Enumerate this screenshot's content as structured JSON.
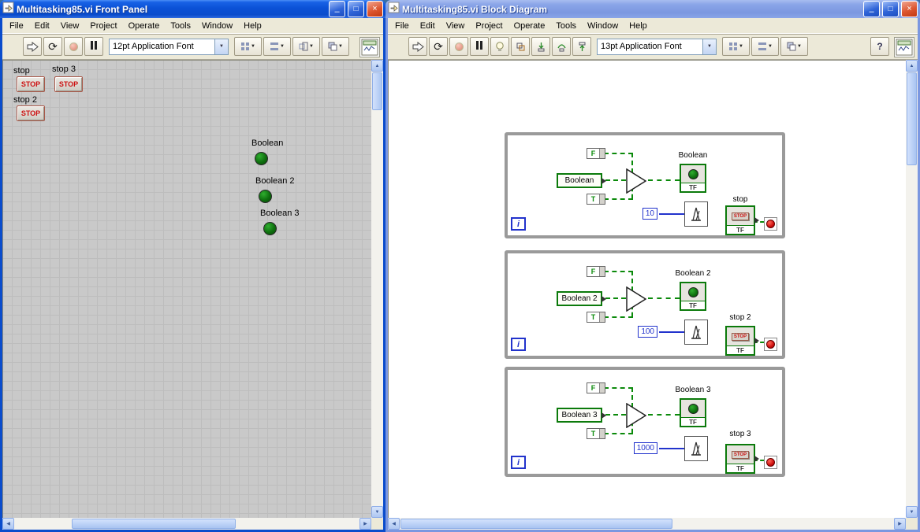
{
  "icons": {
    "minimize": "–",
    "maximize": "□",
    "close": "×",
    "dropdown": "▼",
    "scroll_up": "▲",
    "scroll_down": "▼",
    "scroll_left": "◀",
    "scroll_right": "▶",
    "run_continuous": "⟳"
  },
  "front_panel": {
    "title": "Multitasking85.vi Front Panel",
    "menu": [
      "File",
      "Edit",
      "View",
      "Project",
      "Operate",
      "Tools",
      "Window",
      "Help"
    ],
    "toolbar": {
      "font_selector": "12pt Application Font"
    },
    "stop_buttons": [
      {
        "label": "stop",
        "text": "STOP"
      },
      {
        "label": "stop 3",
        "text": "STOP"
      },
      {
        "label": "stop 2",
        "text": "STOP"
      }
    ],
    "leds": [
      {
        "label": "Boolean"
      },
      {
        "label": "Boolean 2"
      },
      {
        "label": "Boolean 3"
      }
    ]
  },
  "block_diagram": {
    "title": "Multitasking85.vi Block Diagram",
    "menu": [
      "File",
      "Edit",
      "View",
      "Project",
      "Operate",
      "Tools",
      "Window",
      "Help"
    ],
    "toolbar": {
      "font_selector": "13pt Application Font",
      "help": "?"
    },
    "glyphs": {
      "false_const": "F",
      "true_const": "T",
      "tf": "TF",
      "iteration": "i",
      "stop": "STOP"
    },
    "loops": [
      {
        "control_label": "Boolean",
        "indicator_label": "Boolean",
        "wait_ms": "10",
        "stop_label": "stop"
      },
      {
        "control_label": "Boolean 2",
        "indicator_label": "Boolean 2",
        "wait_ms": "100",
        "stop_label": "stop 2"
      },
      {
        "control_label": "Boolean 3",
        "indicator_label": "Boolean 3",
        "wait_ms": "1000",
        "stop_label": "stop 3"
      }
    ]
  }
}
